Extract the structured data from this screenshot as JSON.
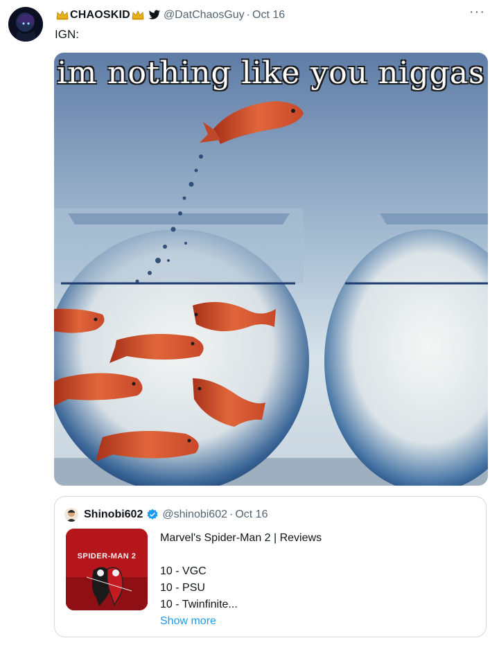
{
  "tweet": {
    "display_name": "CHAOSKID",
    "handle": "@DatChaosGuy",
    "separator": "·",
    "date": "Oct 16",
    "more_label": "···",
    "text": "IGN:",
    "media": {
      "caption": "im nothing like you niggas"
    }
  },
  "quote": {
    "display_name": "Shinobi602",
    "handle": "@shinobi602",
    "separator": "·",
    "date": "Oct 16",
    "thumbnail_title": "SPIDER-MAN 2",
    "title": "Marvel's Spider-Man 2 | Reviews",
    "scores": [
      "10 - VGC",
      "10 - PSU",
      "10 - Twinfinite..."
    ],
    "show_more": "Show more"
  },
  "colors": {
    "link": "#1d9bf0",
    "muted_text": "#536471",
    "quote_border": "#cfd9de",
    "crown": "#e8b21a"
  }
}
